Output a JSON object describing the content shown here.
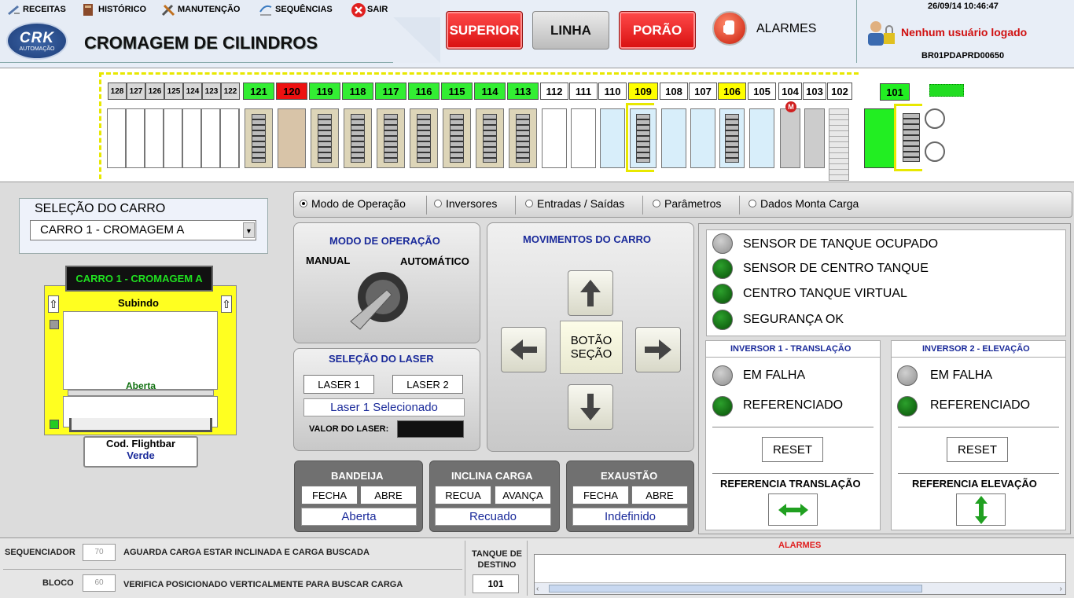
{
  "menu": {
    "receitas": "RECEITAS",
    "historico": "HISTÓRICO",
    "manutencao": "MANUTENÇÃO",
    "sequencias": "SEQUÊNCIAS",
    "sair": "SAIR"
  },
  "logo": {
    "text": "CRK",
    "sub": "AUTOMAÇÃO"
  },
  "title": "CROMAGEM DE CILINDROS",
  "top_buttons": {
    "superior": "SUPERIOR",
    "linha": "LINHA",
    "porao": "PORÃO"
  },
  "alarms_label": "ALARMES",
  "datetime": "26/09/14 10:46:47",
  "user_status": "Nenhum usuário logado",
  "station": "BR01PDAPRD00650",
  "tanks_small": [
    "128",
    "127",
    "126",
    "125",
    "124",
    "123",
    "122"
  ],
  "tanks": [
    {
      "n": "121",
      "color": "#33ee33"
    },
    {
      "n": "120",
      "color": "#ee1111"
    },
    {
      "n": "119",
      "color": "#33ee33"
    },
    {
      "n": "118",
      "color": "#33ee33"
    },
    {
      "n": "117",
      "color": "#33ee33"
    },
    {
      "n": "116",
      "color": "#33ee33"
    },
    {
      "n": "115",
      "color": "#33ee33"
    },
    {
      "n": "114",
      "color": "#33ee33"
    },
    {
      "n": "113",
      "color": "#33ee33"
    },
    {
      "n": "112",
      "color": "#ffffff"
    },
    {
      "n": "111",
      "color": "#ffffff"
    },
    {
      "n": "110",
      "color": "#ffffff"
    },
    {
      "n": "109",
      "color": "#ffff00"
    },
    {
      "n": "108",
      "color": "#ffffff"
    },
    {
      "n": "107",
      "color": "#ffffff"
    },
    {
      "n": "106",
      "color": "#ffff00"
    },
    {
      "n": "105",
      "color": "#ffffff"
    },
    {
      "n": "104",
      "color": "#ffffff"
    },
    {
      "n": "103",
      "color": "#ffffff"
    },
    {
      "n": "102",
      "color": "#ffffff"
    }
  ],
  "tank_101": "101",
  "motor_label": "M",
  "car_selection": {
    "label": "SELEÇÃO DO CARRO",
    "selected": "CARRO 1 - CROMAGEM A"
  },
  "car": {
    "name": "CARRO 1 - CROMAGEM A",
    "status": "Subindo",
    "door": "Aberta",
    "flightbar_label": "Cod. Flightbar",
    "flightbar_color": "Verde"
  },
  "tabs": [
    "Modo de Operação",
    "Inversores",
    "Entradas / Saídas",
    "Parâmetros",
    "Dados Monta Carga"
  ],
  "mode": {
    "title": "MODO DE OPERAÇÃO",
    "manual": "MANUAL",
    "auto": "AUTOMÁTICO"
  },
  "laser": {
    "title": "SELEÇÃO DO LASER",
    "btn1": "LASER 1",
    "btn2": "LASER 2",
    "selected": "Laser 1 Selecionado",
    "value_label": "VALOR DO LASER:"
  },
  "movements": {
    "title": "MOVIMENTOS DO CARRO",
    "center": "BOTÃO SEÇÃO"
  },
  "bandeja": {
    "title": "BANDEIJA",
    "b1": "FECHA",
    "b2": "ABRE",
    "value": "Aberta"
  },
  "inclina": {
    "title": "INCLINA CARGA",
    "b1": "RECUA",
    "b2": "AVANÇA",
    "value": "Recuado"
  },
  "exaustao": {
    "title": "EXAUSTÃO",
    "b1": "FECHA",
    "b2": "ABRE",
    "value": "Indefinido"
  },
  "sensors": [
    {
      "label": "SENSOR DE TANQUE OCUPADO",
      "on": false
    },
    {
      "label": "SENSOR DE CENTRO TANQUE",
      "on": true
    },
    {
      "label": "CENTRO TANQUE VIRTUAL",
      "on": true
    },
    {
      "label": "SEGURANÇA OK",
      "on": true
    }
  ],
  "inv1": {
    "title": "INVERSOR 1 - TRANSLAÇÃO",
    "fault": "EM FALHA",
    "ref": "REFERENCIADO",
    "reset": "RESET",
    "refbtn": "REFERENCIA TRANSLAÇÃO"
  },
  "inv2": {
    "title": "INVERSOR 2 - ELEVAÇÃO",
    "fault": "EM FALHA",
    "ref": "REFERENCIADO",
    "reset": "RESET",
    "refbtn": "REFERENCIA ELEVAÇÃO"
  },
  "footer": {
    "seq_label": "SEQUENCIADOR",
    "seq_value": "70",
    "seq_msg": "AGUARDA CARGA ESTAR INCLINADA E CARGA BUSCADA",
    "bloco_label": "BLOCO",
    "bloco_value": "60",
    "bloco_msg": "VERIFICA POSICIONADO VERTICALMENTE PARA BUSCAR CARGA",
    "tanque_label": "TANQUE DE DESTINO",
    "tanque_value": "101",
    "alarms_title": "ALARMES"
  },
  "colors": {
    "accent_red": "#d81010",
    "title_blue": "#1a2a9a",
    "led_green": "#0a6a0a",
    "car_yellow": "#ffff20"
  }
}
